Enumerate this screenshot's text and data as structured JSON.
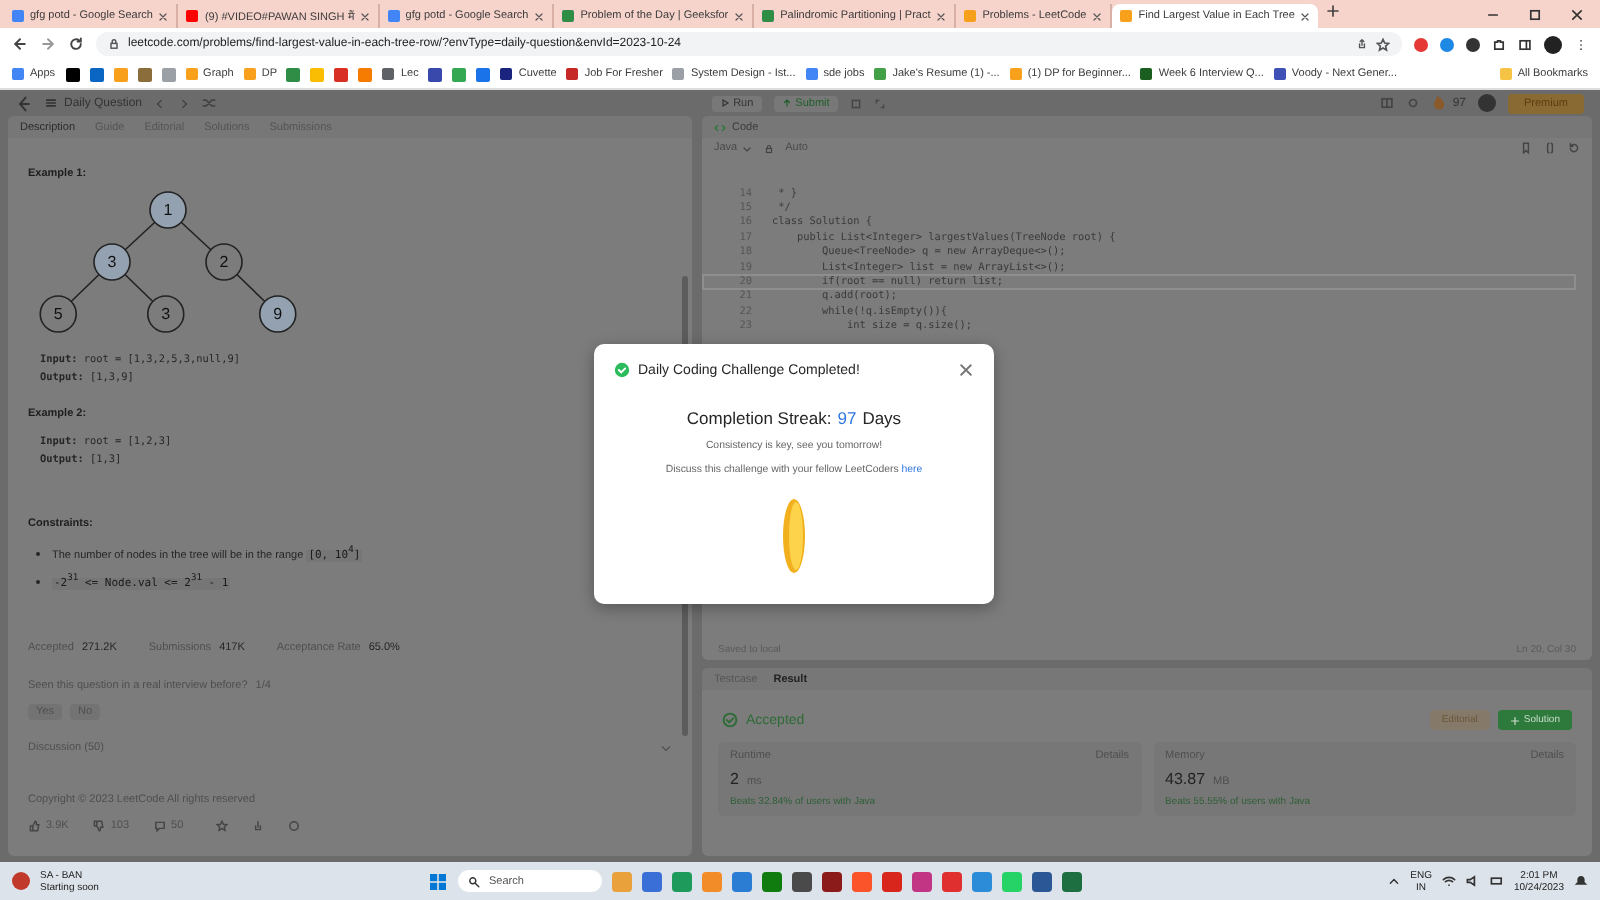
{
  "browser": {
    "tabs": [
      {
        "title": "gfg potd - Google Search",
        "selected": false,
        "color": "#4285f4"
      },
      {
        "title": "(9) #VIDEO#PAWAN SINGH मैं",
        "selected": false,
        "color": "#ff0000"
      },
      {
        "title": "gfg potd - Google Search",
        "selected": false,
        "color": "#4285f4"
      },
      {
        "title": "Problem of the Day | Geeksfor",
        "selected": false,
        "color": "#2f8d46"
      },
      {
        "title": "Palindromic Partitioning | Pract",
        "selected": false,
        "color": "#2f8d46"
      },
      {
        "title": "Problems - LeetCode",
        "selected": false,
        "color": "#f89f1b"
      },
      {
        "title": "Find Largest Value in Each Tree",
        "selected": true,
        "color": "#f89f1b"
      }
    ],
    "address": "leetcode.com/problems/find-largest-value-in-each-tree-row/?envType=daily-question&envId=2023-10-24",
    "bookmarks": [
      {
        "kind": "link",
        "label": "Apps",
        "color": "#4285f4"
      },
      {
        "kind": "icon",
        "color": "#000000"
      },
      {
        "kind": "icon",
        "color": "#0a66c2"
      },
      {
        "kind": "icon",
        "color": "#f89f1b"
      },
      {
        "kind": "icon",
        "color": "#8a6d3b"
      },
      {
        "kind": "icon",
        "color": "#9aa0a6"
      },
      {
        "kind": "link",
        "label": "Graph",
        "color": "#f89f1b"
      },
      {
        "kind": "link",
        "label": "DP",
        "color": "#f89f1b"
      },
      {
        "kind": "icon",
        "color": "#2f8d46"
      },
      {
        "kind": "icon",
        "color": "#fbbc04"
      },
      {
        "kind": "icon",
        "color": "#d93025"
      },
      {
        "kind": "icon",
        "color": "#f57c00"
      },
      {
        "kind": "link",
        "label": "Lec",
        "color": "#5f6368"
      },
      {
        "kind": "icon",
        "color": "#3949ab"
      },
      {
        "kind": "icon",
        "color": "#34a853"
      },
      {
        "kind": "icon",
        "color": "#1a73e8"
      },
      {
        "kind": "link",
        "label": "Cuvette",
        "color": "#1a237e"
      },
      {
        "kind": "link",
        "label": "Job For Fresher",
        "color": "#c62828"
      },
      {
        "kind": "link",
        "label": "System Design - Ist...",
        "color": "#9aa0a6"
      },
      {
        "kind": "link",
        "label": "sde jobs",
        "color": "#4285f4"
      },
      {
        "kind": "link",
        "label": "Jake's Resume (1) -...",
        "color": "#43a047"
      },
      {
        "kind": "link",
        "label": "(1) DP for Beginner...",
        "color": "#f89f1b"
      },
      {
        "kind": "link",
        "label": "Week 6 Interview Q...",
        "color": "#1b5e20"
      },
      {
        "kind": "link",
        "label": "Voody - Next Gener...",
        "color": "#3f51b5"
      }
    ],
    "all_bookmarks": "All Bookmarks"
  },
  "leetcode": {
    "nav": {
      "title": "Daily Question",
      "run": "Run",
      "submit": "Submit",
      "streak": "97",
      "premium": "Premium"
    },
    "tabs": [
      {
        "label": "Description",
        "selected": true
      },
      {
        "label": "Guide",
        "selected": false
      },
      {
        "label": "Editorial",
        "selected": false
      },
      {
        "label": "Solutions",
        "selected": false
      },
      {
        "label": "Submissions",
        "selected": false
      }
    ],
    "example1": {
      "title": "Example 1:",
      "tree": {
        "value": "1",
        "highlighted": true,
        "children": [
          {
            "value": "3",
            "highlighted": true,
            "children": [
              {
                "value": "5",
                "highlighted": false
              },
              {
                "value": "3",
                "highlighted": false
              }
            ]
          },
          {
            "value": "2",
            "highlighted": false,
            "children": [
              {
                "value": "9",
                "highlighted": true,
                "right": true
              }
            ]
          }
        ]
      },
      "input_label": "Input:",
      "input": "root = [1,3,2,5,3,null,9]",
      "output_label": "Output:",
      "output": "[1,3,9]"
    },
    "example2": {
      "title": "Example 2:",
      "input_label": "Input:",
      "input": "root = [1,2,3]",
      "output_label": "Output:",
      "output": "[1,3]"
    },
    "constraints": {
      "title": "Constraints:",
      "items": [
        {
          "text": "The number of nodes in the tree will be in the range",
          "code": "[0, 10$^{4}$]"
        },
        {
          "code": "-2$^{31}$ <= Node.val <= 2$^{31}$ - 1"
        }
      ]
    },
    "stats": [
      {
        "label": "Accepted",
        "value": "271.2K"
      },
      {
        "label": "Submissions",
        "value": "417K"
      },
      {
        "label": "Acceptance Rate",
        "value": "65.0%"
      }
    ],
    "interview": {
      "question": "Seen this question in a real interview before?",
      "count": "1/4",
      "answers": [
        "Yes",
        "No"
      ]
    },
    "discussion": "Discussion (50)",
    "copyright": "Copyright © 2023 LeetCode All rights reserved",
    "reactions": {
      "likes": "3.9K",
      "dislikes": "103",
      "comments": "50"
    },
    "code": {
      "title": "Code",
      "language": "Java",
      "mode": "Auto",
      "lines": [
        {
          "number": "14",
          "text": " * }",
          "current": false
        },
        {
          "number": "15",
          "text": " */",
          "current": false
        },
        {
          "number": "16",
          "text": "class Solution {",
          "current": false
        },
        {
          "number": "17",
          "text": "    public List<Integer> largestValues(TreeNode root) {",
          "current": false
        },
        {
          "number": "18",
          "text": "        Queue<TreeNode> q = new ArrayDeque<>();",
          "current": false
        },
        {
          "number": "19",
          "text": "        List<Integer> list = new ArrayList<>();",
          "current": false
        },
        {
          "number": "20",
          "text": "        if(root == null) return list;",
          "current": true
        },
        {
          "number": "21",
          "text": "        q.add(root);",
          "current": false
        },
        {
          "number": "22",
          "text": "        while(!q.isEmpty()){",
          "current": false
        },
        {
          "number": "23",
          "text": "            int size = q.size();",
          "current": false
        }
      ],
      "saved": "Saved to local",
      "cursor": "Ln 20, Col 30"
    },
    "result": {
      "tabs": [
        {
          "label": "Testcase",
          "selected": false
        },
        {
          "label": "Result",
          "selected": true
        }
      ],
      "status": "Accepted",
      "editorial": "Editorial",
      "solution": "Solution",
      "cards": [
        {
          "title": "Runtime",
          "details": "Details",
          "value": "2",
          "unit": "ms",
          "beats": "Beats 32.84% of users with Java"
        },
        {
          "title": "Memory",
          "details": "Details",
          "value": "43.87",
          "unit": "MB",
          "beats": "Beats 55.55% of users with Java"
        }
      ]
    }
  },
  "modal": {
    "title": "Daily Coding Challenge Completed!",
    "streak_label": "Completion Streak:",
    "streak": "97",
    "streak_unit": "Days",
    "message": "Consistency is key, see you tomorrow!",
    "discuss": "Discuss this challenge with your fellow LeetCoders",
    "link": "here"
  },
  "taskbar": {
    "weather": {
      "title": "SA - BAN",
      "subtitle": "Starting soon"
    },
    "search": {
      "placeholder": "Search"
    },
    "apps": [
      {
        "color": "#e9a23b"
      },
      {
        "color": "#3a6fd8"
      },
      {
        "color": "#1e9b5b"
      },
      {
        "color": "#f28c28"
      },
      {
        "color": "#2b7cd3"
      },
      {
        "color": "#107c10"
      },
      {
        "color": "#4a4a4a"
      },
      {
        "color": "#8b1a1a"
      },
      {
        "color": "#fb542b"
      },
      {
        "color": "#d9261c"
      },
      {
        "color": "#c13584"
      },
      {
        "color": "#e02f2f"
      },
      {
        "color": "#2d8cd8"
      },
      {
        "color": "#25d366"
      },
      {
        "color": "#2b5797"
      },
      {
        "color": "#1d6f42"
      }
    ],
    "language": "ENG",
    "region": "IN",
    "time": "2:01 PM",
    "date": "10/24/2023"
  }
}
